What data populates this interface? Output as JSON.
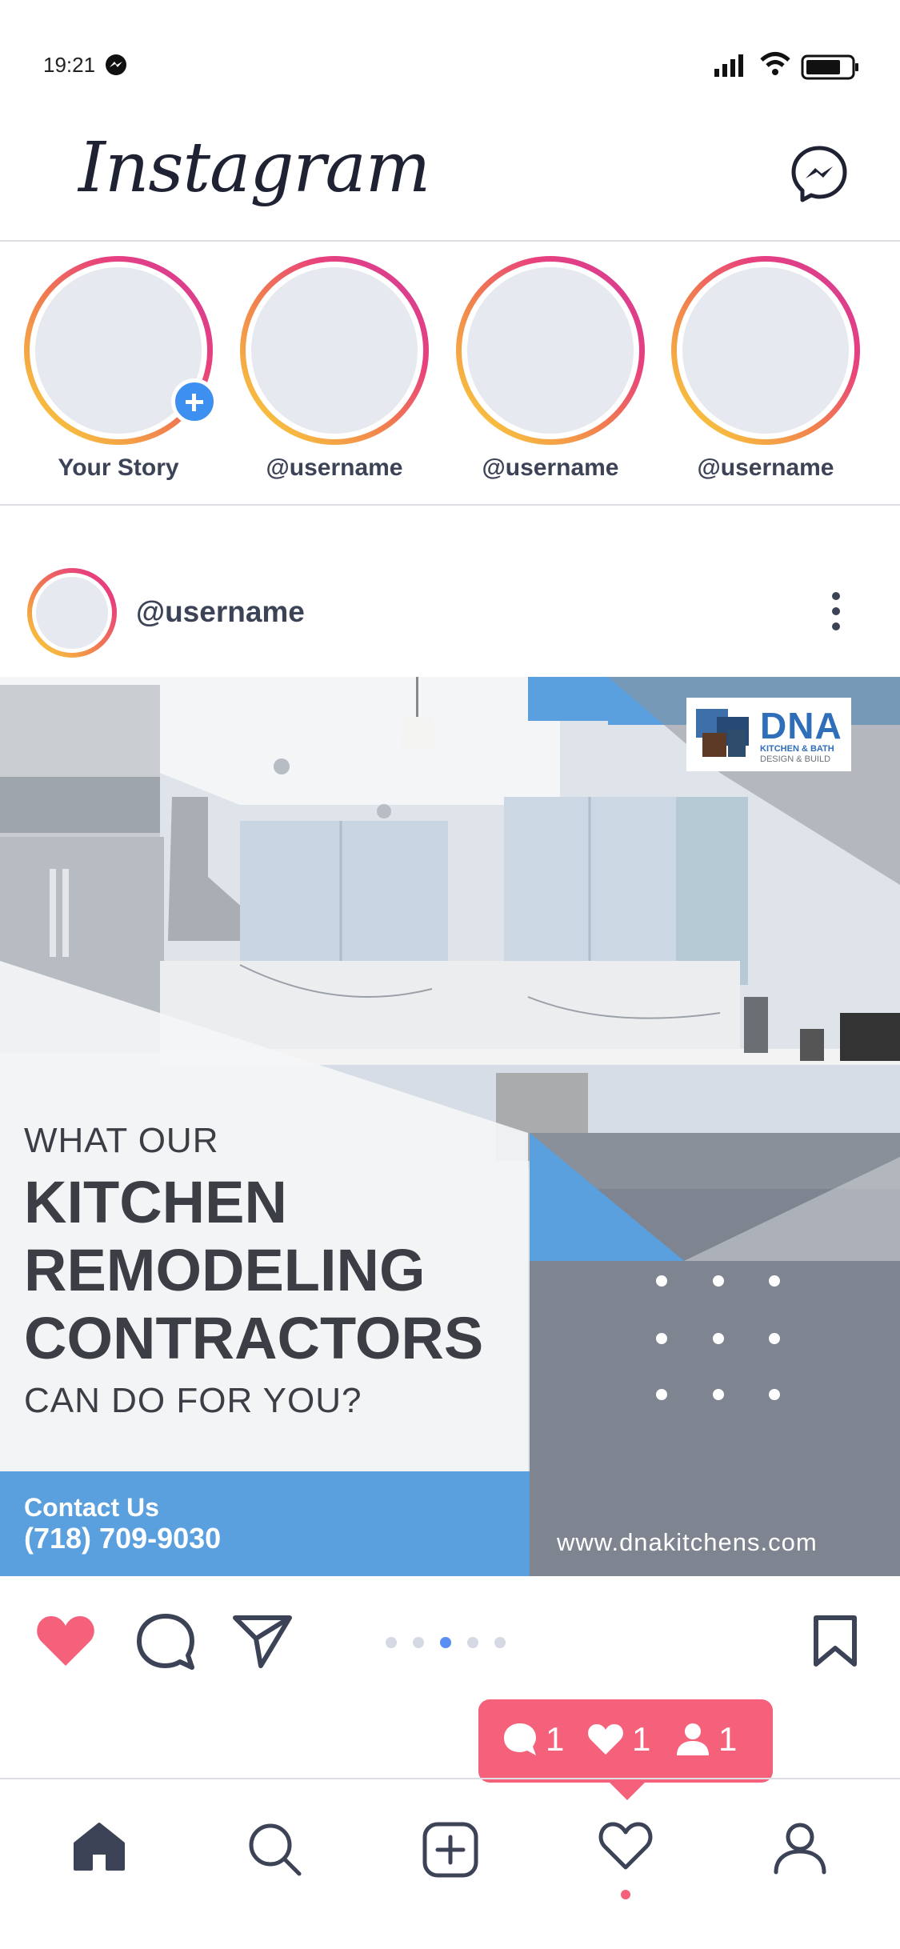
{
  "status_bar": {
    "time": "19:21"
  },
  "header": {
    "logo_text": "Instagram"
  },
  "stories": [
    {
      "label": "Your Story",
      "has_add": true
    },
    {
      "label": "@username"
    },
    {
      "label": "@username"
    },
    {
      "label": "@username"
    }
  ],
  "post": {
    "username": "@username",
    "image": {
      "brand": "DNA",
      "brand_sub1": "KITCHEN & BATH",
      "brand_sub2": "DESIGN & BUILD",
      "line1": "WHAT OUR",
      "line2": "KITCHEN",
      "line3": "REMODELING",
      "line4": "CONTRACTORS",
      "line5": "CAN DO FOR YOU?",
      "contact_label": "Contact Us",
      "phone": "(718) 709-9030",
      "website": "www.dnakitchens.com"
    },
    "carousel": {
      "count": 5,
      "active_index": 2
    }
  },
  "activity_popup": {
    "comments": "1",
    "likes": "1",
    "follows": "1"
  },
  "colors": {
    "accent": "#f5607a",
    "link_blue": "#5b8ef2",
    "text_dark": "#3d4356"
  },
  "icons": [
    "messenger-icon",
    "heart-icon",
    "comment-icon",
    "share-icon",
    "bookmark-icon",
    "home-icon",
    "search-icon",
    "add-icon",
    "activity-icon",
    "profile-icon"
  ]
}
